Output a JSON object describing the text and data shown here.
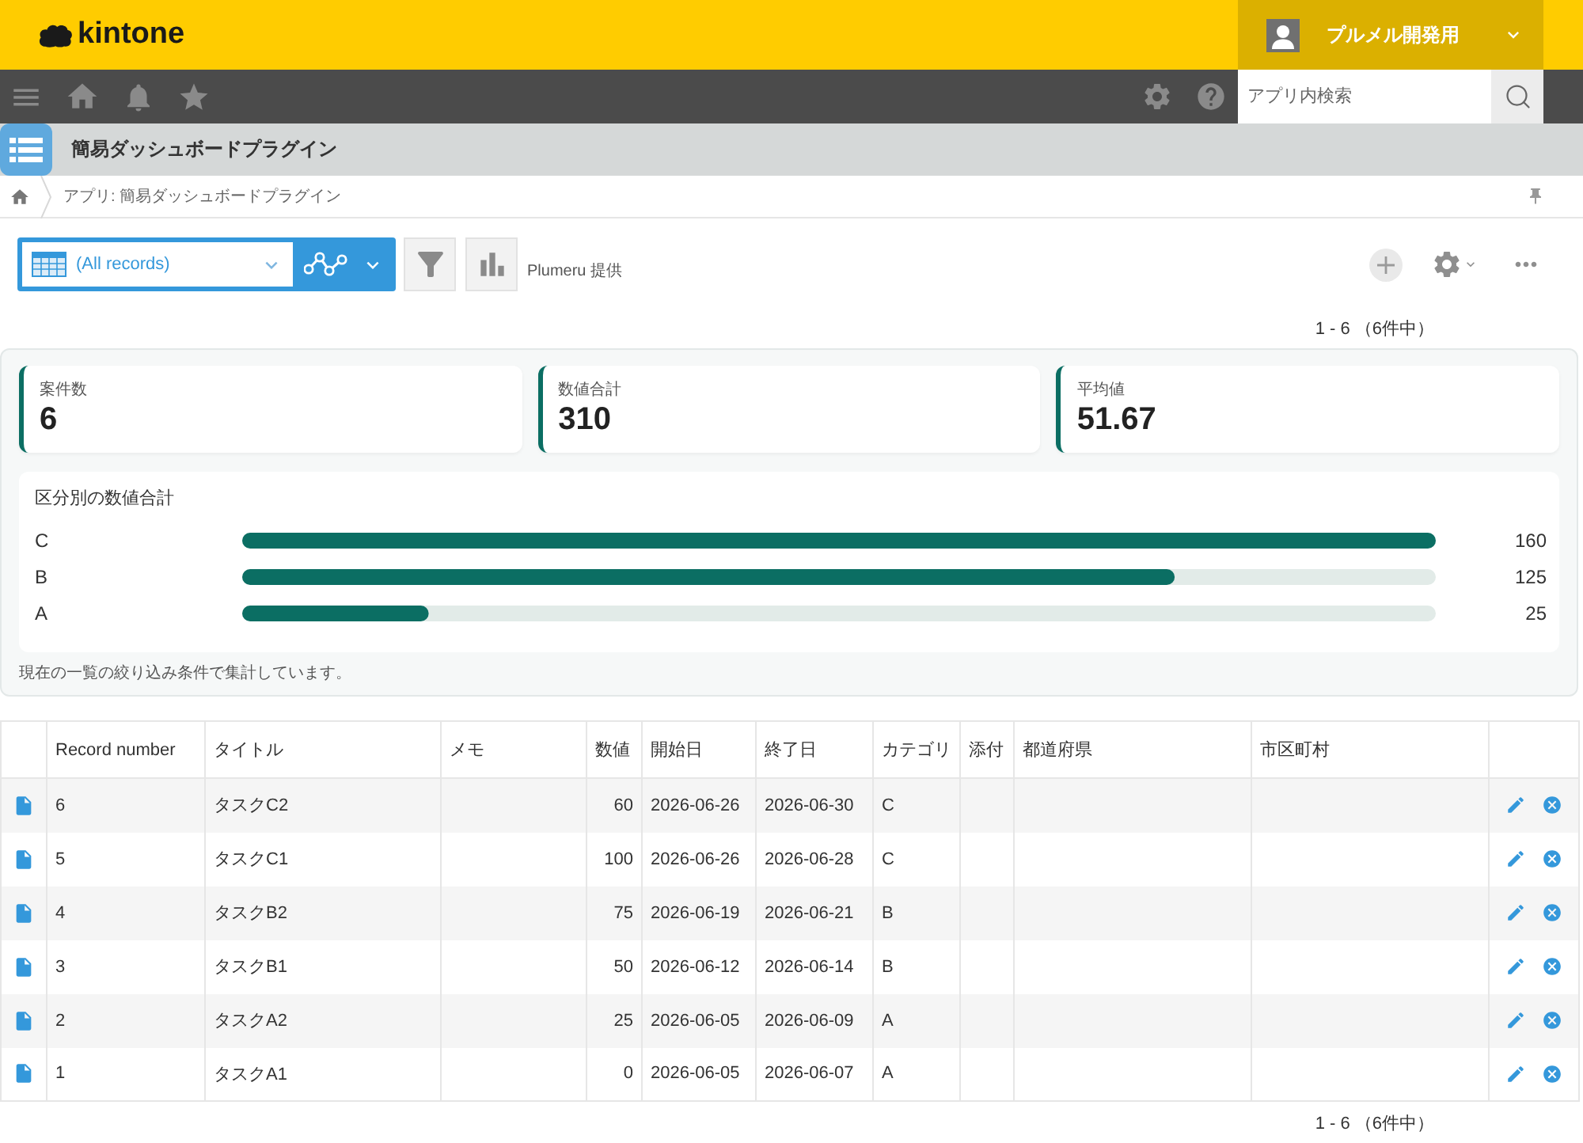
{
  "header": {
    "logo": "kintone",
    "user_name": "プルメル開発用"
  },
  "navbar": {
    "search": {
      "placeholder": "アプリ内検索"
    }
  },
  "app": {
    "title": "簡易ダッシュボードプラグイン",
    "breadcrumb": "アプリ: 簡易ダッシュボードプラグイン"
  },
  "toolbar": {
    "view": "(All records)",
    "credit": "Plumeru 提供"
  },
  "pager_top": "1 - 6 （6件中）",
  "dashboard": {
    "stats": [
      {
        "label": "案件数",
        "value": "6"
      },
      {
        "label": "数値合計",
        "value": "310"
      },
      {
        "label": "平均値",
        "value": "51.67"
      }
    ],
    "chart": {
      "chart_data": {
        "type": "bar",
        "orientation": "horizontal",
        "title": "区分別の数値合計",
        "categories": [
          "C",
          "B",
          "A"
        ],
        "values": [
          160,
          125,
          25
        ],
        "data_labels": true
      }
    },
    "note": "現在の一覧の絞り込み条件で集計しています。"
  },
  "table": {
    "columns": [
      "Record number",
      "タイトル",
      "メモ",
      "数値",
      "開始日",
      "終了日",
      "カテゴリ",
      "添付",
      "都道府県",
      "市区町村"
    ],
    "rows": [
      {
        "record_number": "6",
        "title": "タスクC2",
        "value": "60",
        "start_date": "2026-06-26",
        "end_date": "2026-06-30",
        "category": "C"
      },
      {
        "record_number": "5",
        "title": "タスクC1",
        "value": "100",
        "start_date": "2026-06-26",
        "end_date": "2026-06-28",
        "category": "C"
      },
      {
        "record_number": "4",
        "title": "タスクB2",
        "value": "75",
        "start_date": "2026-06-19",
        "end_date": "2026-06-21",
        "category": "B"
      },
      {
        "record_number": "3",
        "title": "タスクB1",
        "value": "50",
        "start_date": "2026-06-12",
        "end_date": "2026-06-14",
        "category": "B"
      },
      {
        "record_number": "2",
        "title": "タスクA2",
        "value": "25",
        "start_date": "2026-06-05",
        "end_date": "2026-06-09",
        "category": "A"
      },
      {
        "record_number": "1",
        "title": "タスクA1",
        "value": "0",
        "start_date": "2026-06-05",
        "end_date": "2026-06-07",
        "category": "A"
      }
    ]
  },
  "pager_bottom": "1 - 6 （6件中）"
}
